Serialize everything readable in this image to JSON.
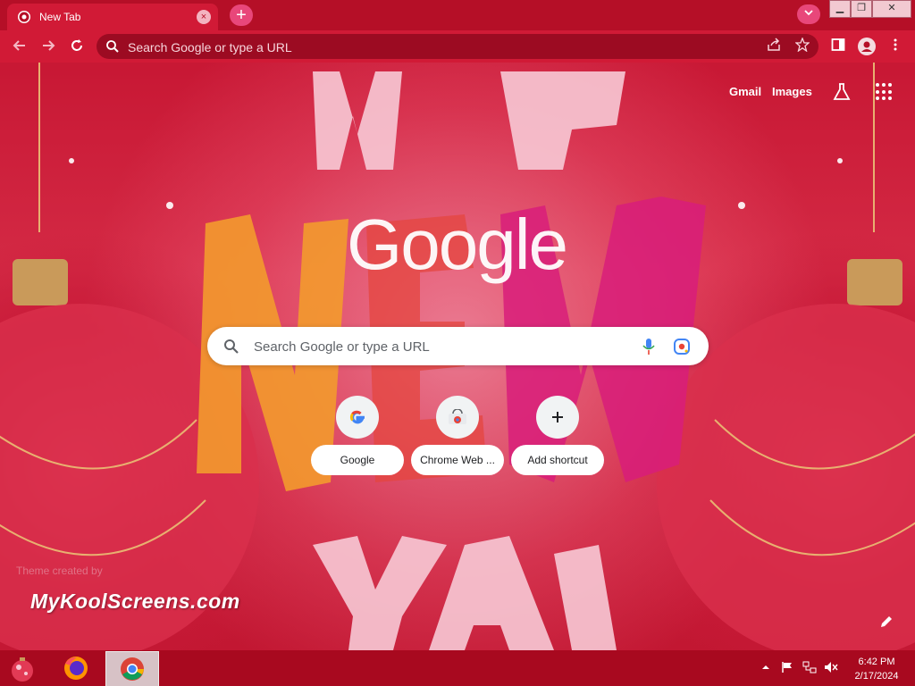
{
  "browser": {
    "tab_title": "New Tab",
    "tab_close_glyph": "×",
    "new_tab_glyph": "+",
    "omnibox_placeholder": "Search Google or type a URL",
    "window_min": "▁",
    "window_restore": "❐",
    "window_close": "✕"
  },
  "header_links": {
    "gmail": "Gmail",
    "images": "Images"
  },
  "google_logo": "Google",
  "search": {
    "placeholder": "Search Google or type a URL"
  },
  "shortcuts": [
    {
      "label": "Google",
      "icon": "google-g-icon"
    },
    {
      "label": "Chrome Web ...",
      "icon": "chrome-web-store-icon"
    },
    {
      "label": "Add shortcut",
      "icon": "plus-icon"
    }
  ],
  "theme_credit": "Theme created by",
  "watermark": "MyKoolScreens.com",
  "taskbar": {
    "time": "6:42 PM",
    "date": "2/17/2024"
  },
  "colors": {
    "tabstrip": "#b50f27",
    "toolbar": "#d11a36",
    "omnibox": "#9c0b22",
    "taskbar": "#a8091f"
  }
}
